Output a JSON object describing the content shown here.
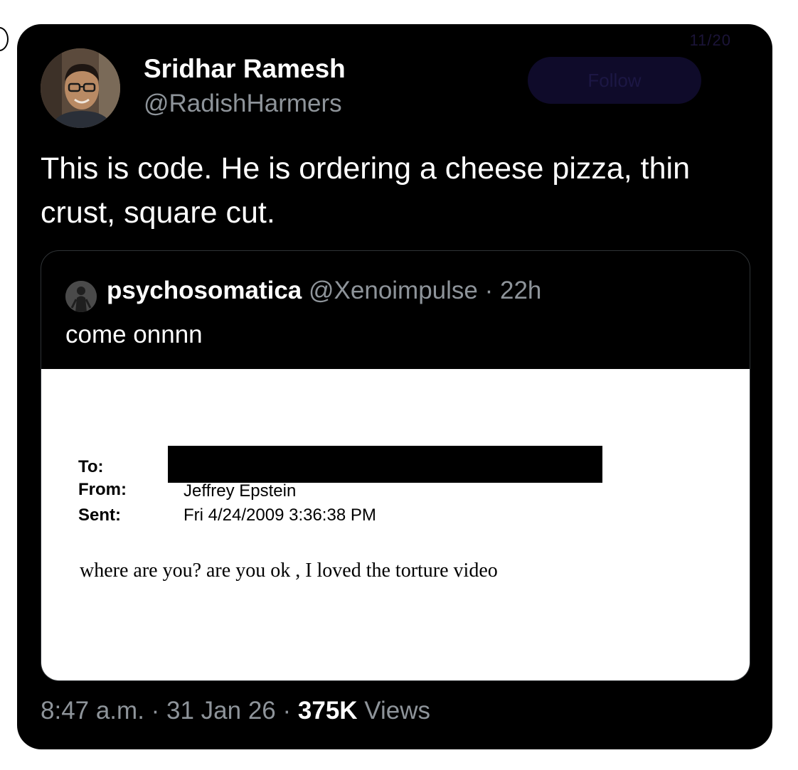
{
  "tweet": {
    "author": {
      "name": "Sridhar Ramesh",
      "handle": "@RadishHarmers"
    },
    "ghost_button": "Follow",
    "ghost_counter": "11/20",
    "text": "This is code. He is ordering a cheese pizza, thin crust, square cut.",
    "timestamp": "8:47 a.m.",
    "separator": " · ",
    "date": "31 Jan 26",
    "views_count": "375K",
    "views_label": "Views"
  },
  "quoted_tweet": {
    "author_name": "psychosomatica",
    "author_handle": "@Xenoimpulse",
    "age": "22h",
    "separator": " · ",
    "text": "come onnnn",
    "email_image": {
      "to_label": "To:",
      "from_label": "From:",
      "from_value": "Jeffrey Epstein",
      "sent_label": "Sent:",
      "sent_value": "Fri 4/24/2009 3:36:38 PM",
      "body": "where are you? are you ok , I loved the torture video"
    }
  },
  "colors": {
    "background": "#000000",
    "primary_text": "#ffffff",
    "secondary_text": "#8e949a",
    "quote_border": "#2f3336",
    "page_background": "#ffffff"
  },
  "icons": {
    "author_avatar": "avatar-photo",
    "quoted_avatar": "avatar-figure"
  }
}
